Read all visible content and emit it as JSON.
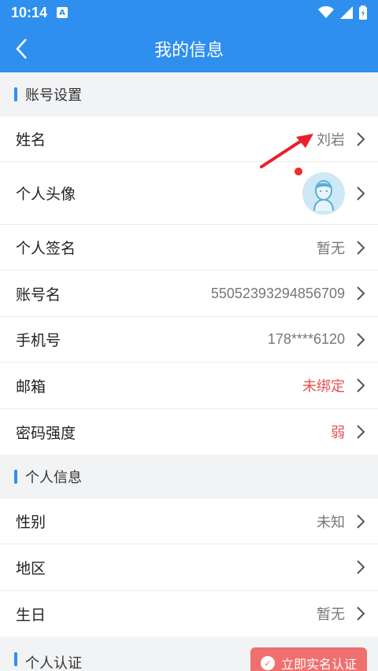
{
  "status_bar": {
    "time": "10:14",
    "notification_icon_letter": "A",
    "icons": [
      "wifi-icon",
      "signal-icon",
      "battery-icon"
    ]
  },
  "nav": {
    "title": "我的信息",
    "back_icon": "back-chevron-icon"
  },
  "sections": [
    {
      "title": "账号设置",
      "rows": [
        {
          "label": "姓名",
          "value": "刘岩"
        },
        {
          "label": "个人头像",
          "value": ""
        },
        {
          "label": "个人签名",
          "value": "暂无"
        },
        {
          "label": "账号名",
          "value": "55052393294856709"
        },
        {
          "label": "手机号",
          "value": "178****6120"
        },
        {
          "label": "邮箱",
          "value": "未绑定"
        },
        {
          "label": "密码强度",
          "value": "弱"
        }
      ]
    },
    {
      "title": "个人信息",
      "rows": [
        {
          "label": "性别",
          "value": "未知"
        },
        {
          "label": "地区",
          "value": ""
        },
        {
          "label": "生日",
          "value": "暂无"
        }
      ]
    },
    {
      "title": "个人认证",
      "button": "立即实名认证"
    }
  ],
  "colors": {
    "primary": "#2f8fef",
    "warning": "#e85050",
    "verify_button": "#f06f6f",
    "annotation_arrow": "#e8202a"
  }
}
